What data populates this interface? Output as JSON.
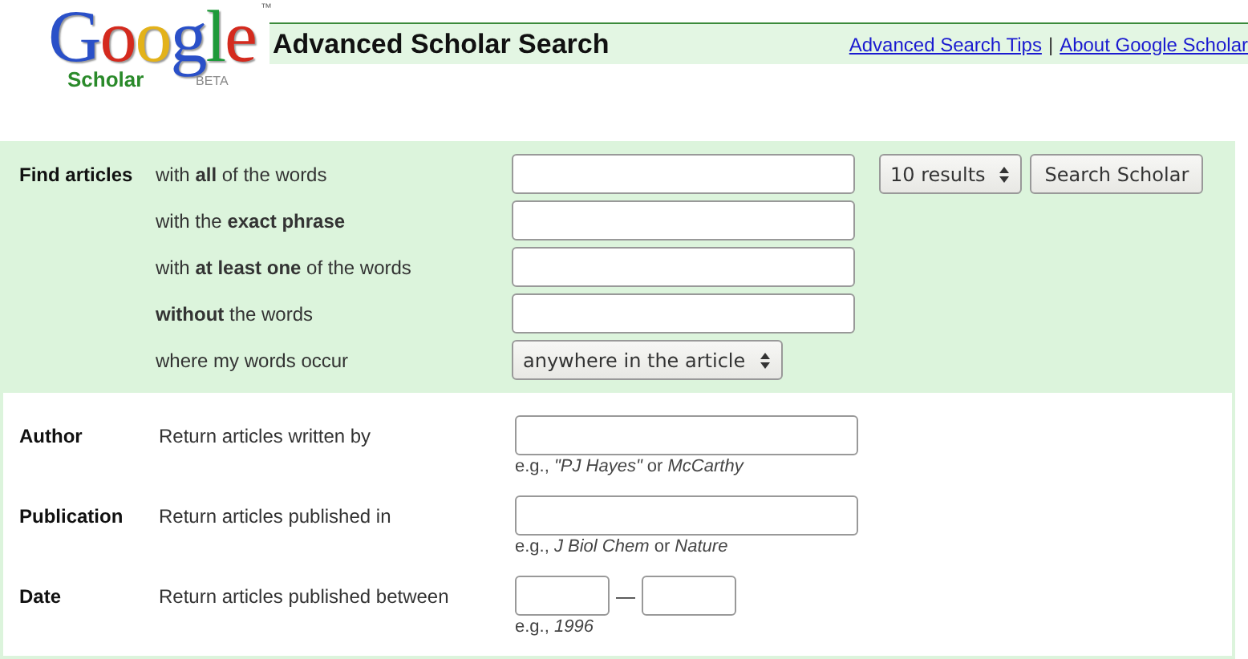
{
  "logo": {
    "letters": [
      {
        "char": "G",
        "color": "#2a50c8"
      },
      {
        "char": "o",
        "color": "#d42a1e"
      },
      {
        "char": "o",
        "color": "#e3b21a"
      },
      {
        "char": "g",
        "color": "#2a50c8"
      },
      {
        "char": "l",
        "color": "#1f9a3a"
      },
      {
        "char": "e",
        "color": "#d42a1e"
      }
    ],
    "trademark": "™",
    "product": "Scholar",
    "badge": "BETA"
  },
  "header": {
    "title": "Advanced Scholar Search",
    "links": [
      {
        "label": "Advanced Search Tips"
      },
      {
        "label": "About Google Scholar"
      }
    ],
    "separator": "|"
  },
  "find": {
    "label": "Find articles",
    "rows": [
      {
        "kind": "input",
        "label": "with **all** of the words"
      },
      {
        "kind": "input",
        "label": "with the **exact phrase**"
      },
      {
        "kind": "input",
        "label": "with **at least one** of the words"
      },
      {
        "kind": "input",
        "label": "**without** the words"
      },
      {
        "kind": "select",
        "label": "where my words occur",
        "value": "anywhere in the article"
      }
    ],
    "results_select": "10 results",
    "search_button": "Search Scholar"
  },
  "criteria": [
    {
      "kind": "input",
      "label": "Author",
      "description": "Return articles written by",
      "hint": "e.g., *\"PJ Hayes\"* or *McCarthy*"
    },
    {
      "kind": "input",
      "label": "Publication",
      "description": "Return articles published in",
      "hint": "e.g., *J Biol Chem* or *Nature*"
    },
    {
      "kind": "range",
      "label": "Date",
      "description": "Return articles published between",
      "separator": "—",
      "hint": "e.g., *1996*"
    }
  ]
}
